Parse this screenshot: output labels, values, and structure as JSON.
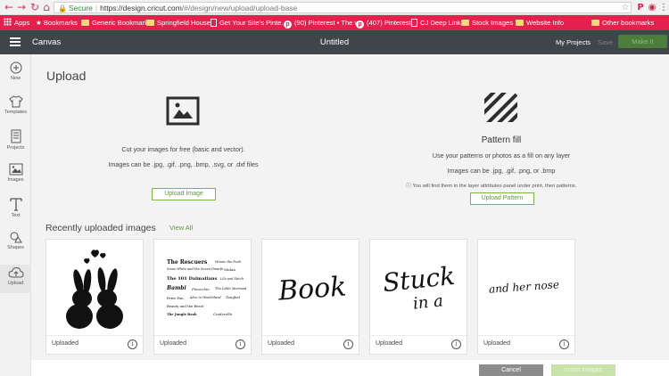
{
  "browser": {
    "url_secure_label": "Secure",
    "url_base": "https://design.cricut.com",
    "url_path": "/#/design/new/upload/upload-base",
    "bookmarks": [
      {
        "label": "Apps",
        "icon": "apps-grid-icon"
      },
      {
        "label": "Bookmarks",
        "icon": "star-icon"
      },
      {
        "label": "Generic Bookmarks",
        "icon": "folder-icon"
      },
      {
        "label": "Springfield House",
        "icon": "folder-icon"
      },
      {
        "label": "Get Your Site's Pinte...",
        "icon": "page-icon"
      },
      {
        "label": "(90) Pinterest • The w",
        "icon": "pinterest-icon"
      },
      {
        "label": "(407) Pinterest",
        "icon": "pinterest-icon"
      },
      {
        "label": "CJ Deep Link",
        "icon": "page-icon"
      },
      {
        "label": "Stock Images",
        "icon": "folder-icon"
      },
      {
        "label": "Website Info",
        "icon": "folder-icon"
      },
      {
        "label": "Other bookmarks",
        "icon": "folder-icon"
      }
    ]
  },
  "header": {
    "app_title": "Canvas",
    "doc_title": "Untitled",
    "my_projects": "My Projects",
    "save": "Save",
    "make_it": "Make It"
  },
  "rail": [
    {
      "label": "New",
      "icon": "plus-circle-icon"
    },
    {
      "label": "Templates",
      "icon": "shirt-icon"
    },
    {
      "label": "Projects",
      "icon": "projects-icon"
    },
    {
      "label": "Images",
      "icon": "image-icon"
    },
    {
      "label": "Text",
      "icon": "text-icon"
    },
    {
      "label": "Shapes",
      "icon": "shapes-icon"
    },
    {
      "label": "Upload",
      "icon": "cloud-upload-icon"
    }
  ],
  "upload": {
    "title": "Upload",
    "image_desc": "Cut your images for free (basic and vector).",
    "image_formats": "Images can be .jpg, .gif, .png, .bmp, .svg, or .dxf files",
    "upload_image_btn": "Upload Image",
    "pattern_title": "Pattern fill",
    "pattern_desc": "Use your patterns or photos as a fill on any layer",
    "pattern_formats": "Images can be .jpg, .gif, .png, or .bmp",
    "pattern_note": "You will find them in the layer attributes panel under print, then patterns.",
    "upload_pattern_btn": "Upload Pattern"
  },
  "recent": {
    "title": "Recently uploaded images",
    "view_all": "View All",
    "items": [
      {
        "label": "Uploaded",
        "thumb": "bunnies"
      },
      {
        "label": "Uploaded",
        "thumb": "disney-titles"
      },
      {
        "label": "Uploaded",
        "thumb_text": "Book"
      },
      {
        "label": "Uploaded",
        "thumb_text": "Stuck",
        "thumb_text2": "in a"
      },
      {
        "label": "Uploaded",
        "thumb_text": "and her nose"
      }
    ]
  },
  "disney_titles": [
    "The Rescuers",
    "Winnie the Pooh",
    "Snow White and the Seven Dwarfs",
    "Mulan",
    "The 101 Dalmatians",
    "Lilo and Stitch",
    "Bambi",
    "Pinocchio",
    "The Little Mermaid",
    "Peter Pan",
    "Alice in Wonderland",
    "Tangled",
    "Beauty and the Beast",
    "The Jungle Book",
    "Cinderella"
  ],
  "footer": {
    "cancel": "Cancel",
    "insert": "Insert Images"
  }
}
